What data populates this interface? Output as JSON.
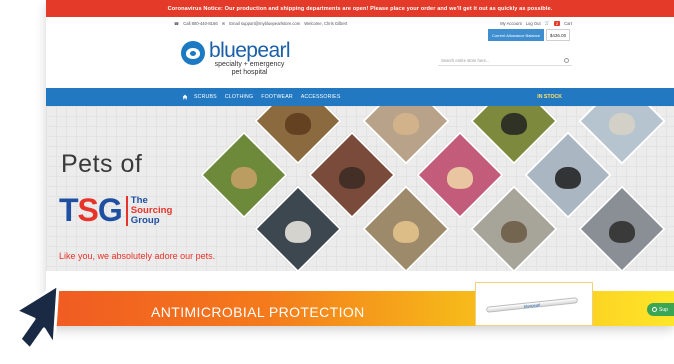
{
  "notice": "Coronavirus Notice: Our production and shipping departments are open! Please place your order and we'll get it out as quickly as possible.",
  "utility": {
    "phone": "Call 800-440-8166",
    "email": "Email support@mybluepearlstore.com",
    "welcome": "Welcome, Chris Gilbert",
    "account": "My Account",
    "logout": "Log Out",
    "cart_count": "2",
    "cart_label": "Cart"
  },
  "logo": {
    "name": "bluepearl",
    "sub1": "specialty + emergency",
    "sub2": "pet hospital"
  },
  "balance": {
    "label": "Current Allowance Balance",
    "value": "$436.00"
  },
  "search": {
    "placeholder": "Search entire store here..."
  },
  "nav": {
    "items": [
      "SCRUBS",
      "CLOTHING",
      "FOOTWEAR",
      "ACCESSORIES"
    ],
    "stock": "IN STOCK"
  },
  "hero": {
    "title": "Pets of",
    "tsg_a": "T",
    "tsg_b": "S",
    "tsg_c": "G",
    "sub1": "The",
    "sub2": "Sourcing",
    "sub3": "Group",
    "tagline": "Like you, we absolutely adore our pets."
  },
  "bottom": {
    "title": "ANTIMICROBIAL PROTECTION",
    "pen_text": "bluepearl",
    "chat": "Sup"
  },
  "icons": [
    "phone-icon",
    "email-icon",
    "cart-icon",
    "home-icon",
    "search-icon",
    "chat-icon",
    "cursor-icon"
  ],
  "colors": {
    "notice": "#e43a2a",
    "nav": "#2379c1",
    "brand": "#1b5fa8",
    "stock": "#ffe36b",
    "tsg_red": "#e7342a"
  }
}
